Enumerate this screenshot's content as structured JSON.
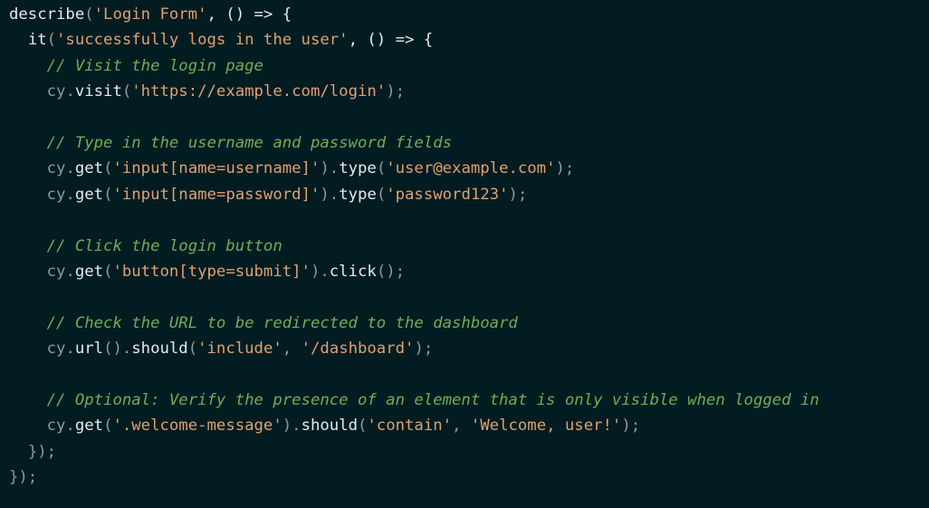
{
  "colors": {
    "background": "#021c22",
    "punctuation": "#8b9ca0",
    "function": "#e4ebec",
    "string": "#e0a070",
    "comment": "#6fae56"
  },
  "code": {
    "l1": {
      "fn": "describe",
      "open": "(",
      "str": "'Login Form'",
      "rest": ", () => {"
    },
    "l2": {
      "indent": "  ",
      "fn": "it",
      "open": "(",
      "str": "'successfully logs in the user'",
      "rest": ", () => {"
    },
    "l3": {
      "indent": "    ",
      "comment": "// Visit the login page"
    },
    "l4": {
      "indent": "    ",
      "obj": "cy",
      "dot": ".",
      "fn": "visit",
      "open": "(",
      "str": "'https://example.com/login'",
      "close": ");"
    },
    "l6": {
      "indent": "    ",
      "comment": "// Type in the username and password fields"
    },
    "l7": {
      "indent": "    ",
      "obj": "cy",
      "dot": ".",
      "fn": "get",
      "open": "(",
      "str": "'input[name=username]'",
      "mid": ").",
      "fn2": "type",
      "open2": "(",
      "str2": "'user@example.com'",
      "close": ");"
    },
    "l8": {
      "indent": "    ",
      "obj": "cy",
      "dot": ".",
      "fn": "get",
      "open": "(",
      "str": "'input[name=password]'",
      "mid": ").",
      "fn2": "type",
      "open2": "(",
      "str2": "'password123'",
      "close": ");"
    },
    "l10": {
      "indent": "    ",
      "comment": "// Click the login button"
    },
    "l11": {
      "indent": "    ",
      "obj": "cy",
      "dot": ".",
      "fn": "get",
      "open": "(",
      "str": "'button[type=submit]'",
      "mid": ").",
      "fn2": "click",
      "close": "();"
    },
    "l13": {
      "indent": "    ",
      "comment": "// Check the URL to be redirected to the dashboard"
    },
    "l14": {
      "indent": "    ",
      "obj": "cy",
      "dot": ".",
      "fn": "url",
      "mid": "().",
      "fn2": "should",
      "open2": "(",
      "str": "'include'",
      "comma": ", ",
      "str2": "'/dashboard'",
      "close": ");"
    },
    "l16": {
      "indent": "    ",
      "comment": "// Optional: Verify the presence of an element that is only visible when logged in"
    },
    "l17": {
      "indent": "    ",
      "obj": "cy",
      "dot": ".",
      "fn": "get",
      "open": "(",
      "str": "'.welcome-message'",
      "mid": ").",
      "fn2": "should",
      "open2": "(",
      "str2": "'contain'",
      "comma": ", ",
      "str3": "'Welcome, user!'",
      "close": ");"
    },
    "l18": {
      "indent": "  ",
      "close": "});"
    },
    "l19": {
      "close": "});"
    }
  }
}
